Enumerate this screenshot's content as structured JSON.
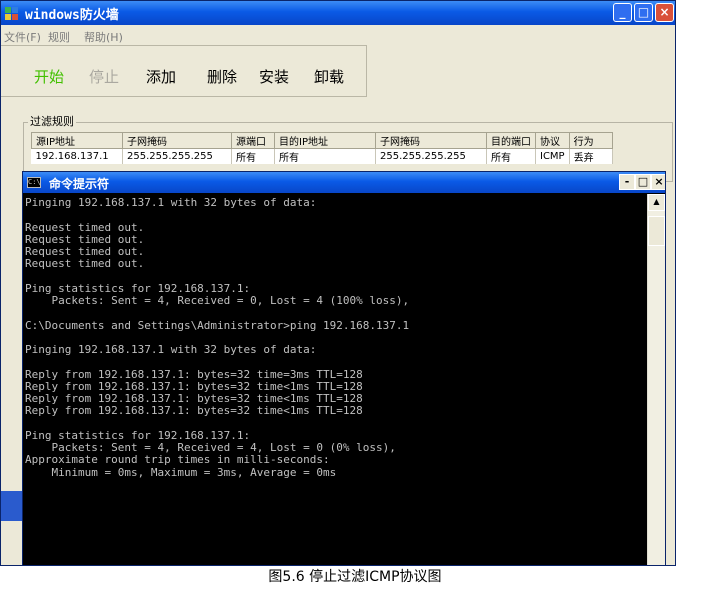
{
  "firewall": {
    "title": "windows防火墙",
    "menu": [
      "文件(F)",
      "规则",
      "帮助(H)"
    ],
    "toolbar": {
      "start": "开始",
      "stop": "停止",
      "add": "添加",
      "delete": "删除",
      "install": "安装",
      "uninstall": "卸载"
    },
    "rules_group": "过滤规则",
    "columns": [
      "源IP地址",
      "子网掩码",
      "源端口",
      "目的IP地址",
      "子网掩码",
      "目的端口",
      "协议",
      "行为"
    ],
    "rows": [
      [
        "192.168.137.1",
        "255.255.255.255",
        "所有",
        "所有",
        "255.255.255.255",
        "所有",
        "ICMP",
        "丢弃"
      ]
    ]
  },
  "cmd": {
    "title": "命令提示符",
    "icon_text": "C:\\",
    "lines": [
      "Pinging 192.168.137.1 with 32 bytes of data:",
      "",
      "Request timed out.",
      "Request timed out.",
      "Request timed out.",
      "Request timed out.",
      "",
      "Ping statistics for 192.168.137.1:",
      "    Packets: Sent = 4, Received = 0, Lost = 4 (100% loss),",
      "",
      "C:\\Documents and Settings\\Administrator>ping 192.168.137.1",
      "",
      "Pinging 192.168.137.1 with 32 bytes of data:",
      "",
      "Reply from 192.168.137.1: bytes=32 time=3ms TTL=128",
      "Reply from 192.168.137.1: bytes=32 time<1ms TTL=128",
      "Reply from 192.168.137.1: bytes=32 time<1ms TTL=128",
      "Reply from 192.168.137.1: bytes=32 time<1ms TTL=128",
      "",
      "Ping statistics for 192.168.137.1:",
      "    Packets: Sent = 4, Received = 4, Lost = 0 (0% loss),",
      "Approximate round trip times in milli-seconds:",
      "    Minimum = 0ms, Maximum = 3ms, Average = 0ms"
    ]
  },
  "caption": "图5.6 停止过滤ICMP协议图"
}
